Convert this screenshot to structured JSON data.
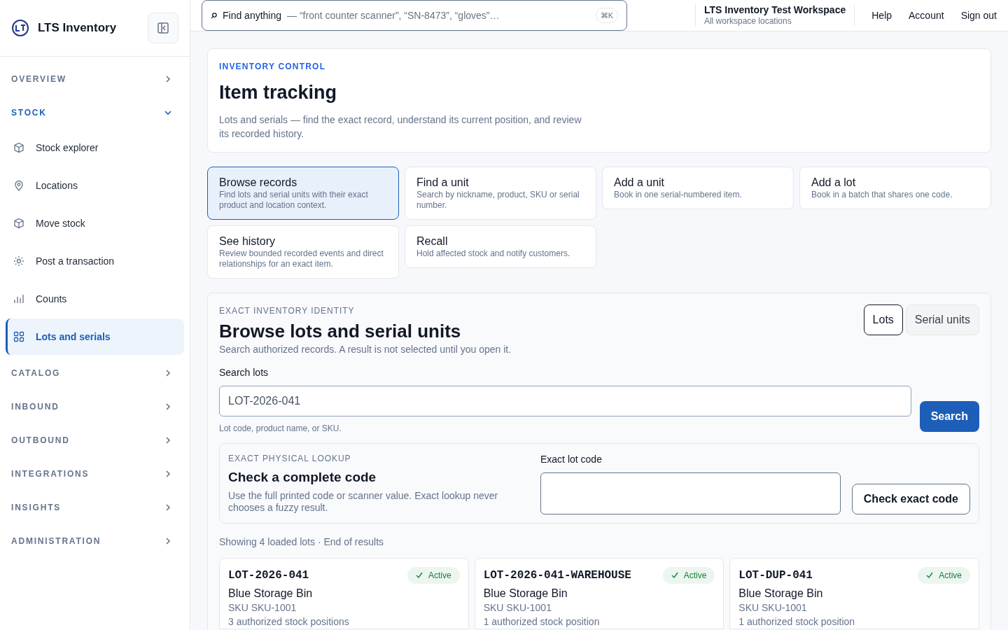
{
  "brand": {
    "name": "LTS Inventory"
  },
  "search": {
    "label": "Find anything",
    "placeholder": "— “front counter scanner”, “SN-8473”, “gloves”…",
    "shortcut": "⌘K"
  },
  "workspace": {
    "name": "LTS Inventory Test Workspace",
    "scope": "All workspace locations"
  },
  "top_links": [
    "Help",
    "Account",
    "Sign out"
  ],
  "sidebar": {
    "groups": [
      {
        "label": "OVERVIEW",
        "expanded": false
      },
      {
        "label": "STOCK",
        "expanded": true,
        "items": [
          {
            "label": "Stock explorer",
            "selected": false
          },
          {
            "label": "Locations",
            "selected": false
          },
          {
            "label": "Move stock",
            "selected": false
          },
          {
            "label": "Post a transaction",
            "selected": false
          },
          {
            "label": "Counts",
            "selected": false
          },
          {
            "label": "Lots and serials",
            "selected": true
          }
        ]
      },
      {
        "label": "CATALOG",
        "expanded": false
      },
      {
        "label": "INBOUND",
        "expanded": false
      },
      {
        "label": "OUTBOUND",
        "expanded": false
      },
      {
        "label": "INTEGRATIONS",
        "expanded": false
      },
      {
        "label": "INSIGHTS",
        "expanded": false
      },
      {
        "label": "ADMINISTRATION",
        "expanded": false
      }
    ]
  },
  "header": {
    "eyebrow": "INVENTORY CONTROL",
    "title": "Item tracking",
    "description": "Lots and serials — find the exact record, understand its current position, and review its recorded history."
  },
  "actions": [
    {
      "title": "Browse records",
      "description": "Find lots and serial units with their exact product and location context.",
      "selected": true
    },
    {
      "title": "Find a unit",
      "description": "Search by nickname, product, SKU or serial number.",
      "selected": false
    },
    {
      "title": "Add a unit",
      "description": "Book in one serial-numbered item.",
      "selected": false
    },
    {
      "title": "Add a lot",
      "description": "Book in a batch that shares one code.",
      "selected": false
    },
    {
      "title": "See history",
      "description": "Review bounded recorded events and direct relationships for an exact item.",
      "selected": false
    },
    {
      "title": "Recall",
      "description": "Hold affected stock and notify customers.",
      "selected": false
    }
  ],
  "browse": {
    "eyebrow": "EXACT INVENTORY IDENTITY",
    "title": "Browse lots and serial units",
    "description": "Search authorized records. A result is not selected until you open it.",
    "toggle": [
      {
        "label": "Lots",
        "selected": true
      },
      {
        "label": "Serial units",
        "selected": false
      }
    ],
    "search_label": "Search lots",
    "search_value": "LOT-2026-041",
    "search_hint": "Lot code, product name, or SKU.",
    "search_button": "Search",
    "exact": {
      "eyebrow": "EXACT PHYSICAL LOOKUP",
      "title": "Check a complete code",
      "description": "Use the full printed code or scanner value. Exact lookup never chooses a fuzzy result.",
      "field_label": "Exact lot code",
      "button": "Check exact code"
    },
    "summary": "Showing 4 loaded lots · End of results",
    "lots": [
      {
        "code": "LOT-2026-041",
        "status": "Active",
        "product": "Blue Storage Bin",
        "sku": "SKU SKU-1001",
        "positions": "3 authorized stock positions"
      },
      {
        "code": "LOT-2026-041-WAREHOUSE",
        "status": "Active",
        "product": "Blue Storage Bin",
        "sku": "SKU SKU-1001",
        "positions": "1 authorized stock position"
      },
      {
        "code": "LOT-DUP-041",
        "status": "Active",
        "product": "Blue Storage Bin",
        "sku": "SKU SKU-1001",
        "positions": "1 authorized stock position"
      }
    ]
  }
}
